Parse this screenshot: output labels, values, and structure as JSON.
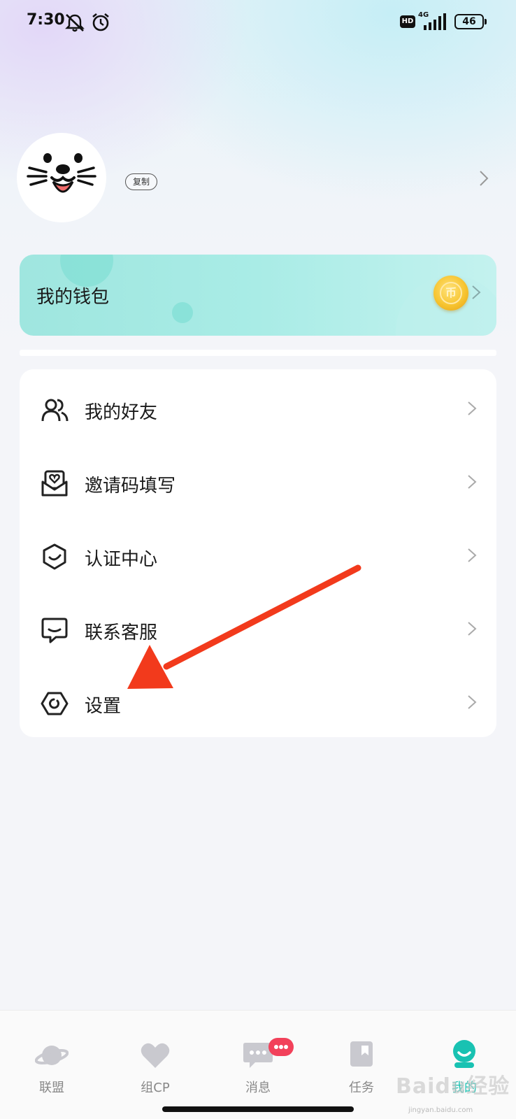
{
  "status_bar": {
    "time": "7:30",
    "hd": "HD",
    "network": "4G",
    "battery": "46"
  },
  "profile": {
    "copy_label": "复制"
  },
  "wallet": {
    "title": "我的钱包",
    "coin_symbol": "币"
  },
  "menu": {
    "items": [
      {
        "label": "我的好友",
        "icon": "friends-icon"
      },
      {
        "label": "邀请码填写",
        "icon": "invite-mail-icon"
      },
      {
        "label": "认证中心",
        "icon": "shield-check-icon"
      },
      {
        "label": "联系客服",
        "icon": "chat-service-icon"
      },
      {
        "label": "设置",
        "icon": "settings-icon"
      }
    ]
  },
  "tabs": [
    {
      "label": "联盟",
      "icon": "planet-icon",
      "active": false
    },
    {
      "label": "组CP",
      "icon": "heart-icon",
      "active": false
    },
    {
      "label": "消息",
      "icon": "message-icon",
      "active": false
    },
    {
      "label": "任务",
      "icon": "task-book-icon",
      "active": false
    },
    {
      "label": "我的",
      "icon": "profile-icon",
      "active": true
    }
  ],
  "watermark": {
    "brand": "Baidu经验",
    "url": "jingyan.baidu.com"
  },
  "colors": {
    "accent": "#19c2b2",
    "badge": "#f2415a",
    "annotation_arrow": "#f23a1c"
  }
}
